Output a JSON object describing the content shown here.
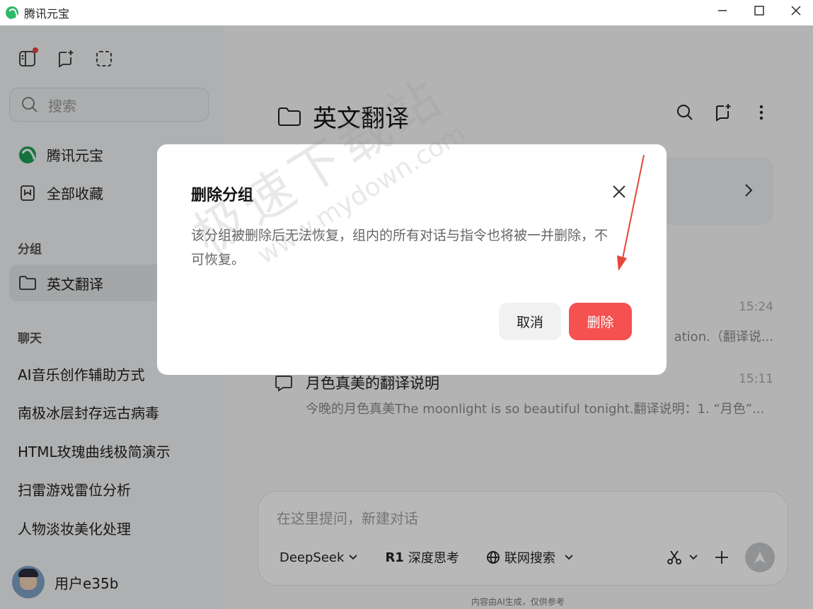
{
  "window": {
    "title": "腾讯元宝"
  },
  "sidebar": {
    "search_placeholder": "搜索",
    "nav": [
      {
        "label": "腾讯元宝",
        "icon": "yuanbao-logo-icon"
      },
      {
        "label": "全部收藏",
        "icon": "bookmark-icon"
      }
    ],
    "groups_label": "分组",
    "groups": [
      {
        "label": "英文翻译",
        "icon": "folder-icon",
        "active": true
      }
    ],
    "chats_label": "聊天",
    "chats": [
      "AI音乐创作辅助方式",
      "南极冰层封存远古病毒",
      "HTML玫瑰曲线极简演示",
      "扫雷游戏雷位分析",
      "人物淡妆美化处理"
    ],
    "user": {
      "name": "用户e35b"
    }
  },
  "main": {
    "folder_title": "英文翻译",
    "conversations": [
      {
        "time": "15:24",
        "subtitle_partial": "ation.（翻译说..."
      },
      {
        "title": "月色真美的翻译说明",
        "time": "15:11",
        "subtitle": "今晚的月色真美The moonlight is so beautiful tonight.翻译说明：1. “月色”..."
      }
    ],
    "input": {
      "placeholder": "在这里提问，新建对话",
      "model": "DeepSeek",
      "deep_think_badge": "R1",
      "deep_think_label": "深度思考",
      "web_search_label": "联网搜索"
    },
    "footer_note": "内容由AI生成，仅供参考"
  },
  "dialog": {
    "title": "删除分组",
    "body": "该分组被删除后无法恢复，组内的所有对话与指令也将被一并删除，不可恢复。",
    "cancel_label": "取消",
    "delete_label": "删除"
  },
  "watermark": {
    "cn": "极速下载站",
    "en": "www.mydown.com"
  },
  "colors": {
    "delete_button": "#f55151",
    "annotation_arrow": "#e8453c",
    "brand_green": "#1e9e57"
  }
}
